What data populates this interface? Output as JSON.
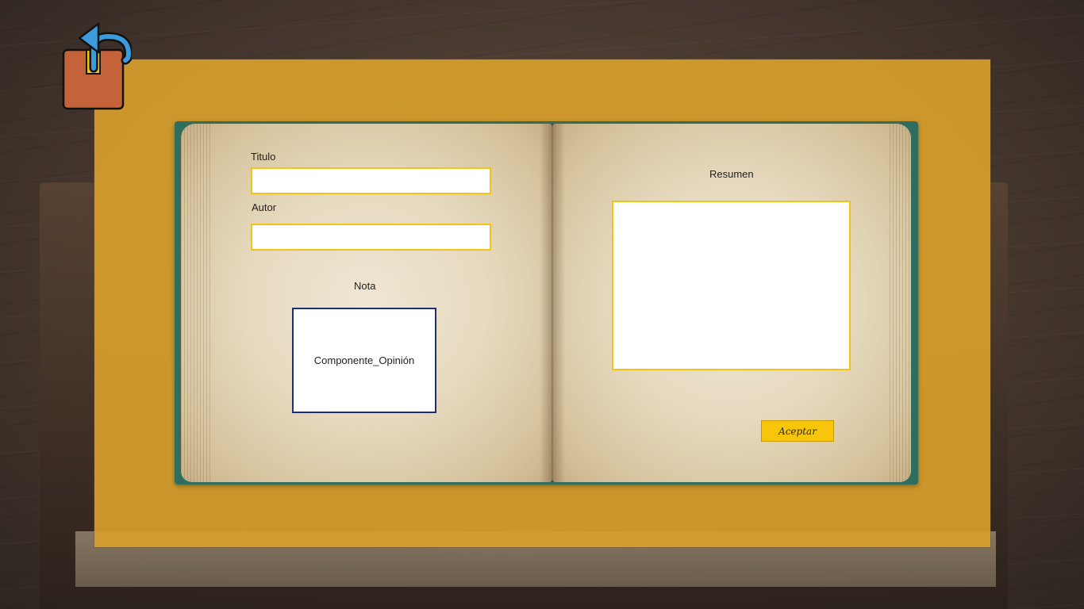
{
  "form": {
    "title_label": "Titulo",
    "title_value": "",
    "author_label": "Autor",
    "author_value": "",
    "rating_label": "Nota",
    "opinion_component_label": "Componente_Opinión",
    "summary_label": "Resumen",
    "summary_value": "",
    "accept_label": "Aceptar"
  },
  "icons": {
    "back": "back-arrow-icon"
  },
  "colors": {
    "panel": "#d69e2c",
    "input_border": "#f3c319",
    "opinion_border": "#1f2f72",
    "accept_button": "#f7c50a",
    "back_icon_body": "#c4623a",
    "back_icon_arrow": "#3d9bdc"
  }
}
